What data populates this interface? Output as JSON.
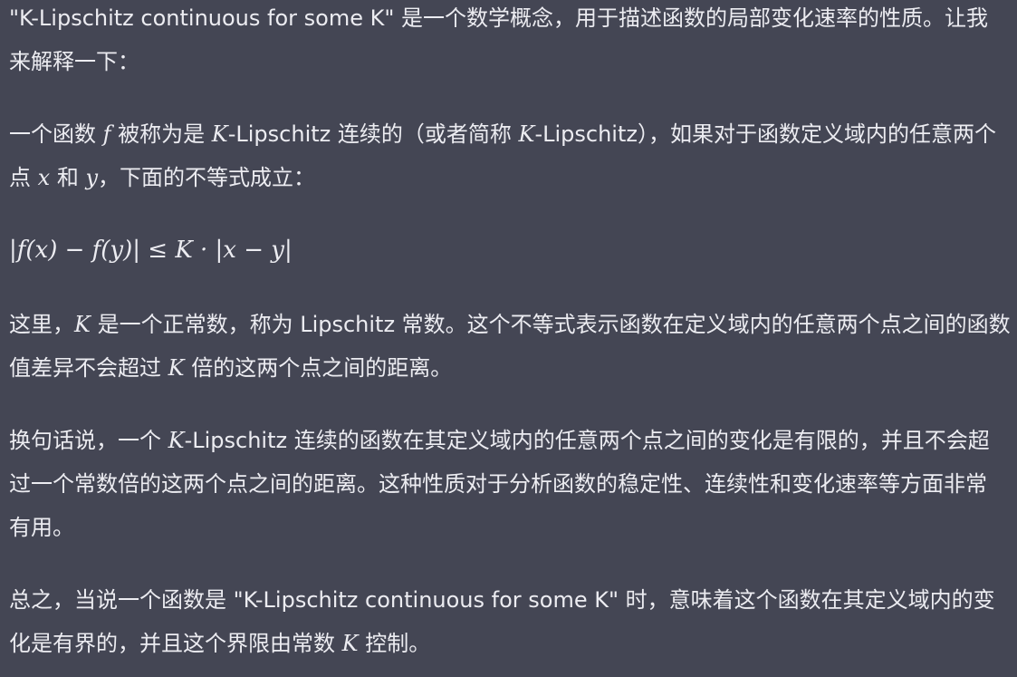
{
  "message": {
    "paragraph_1": "\"K-Lipschitz continuous for some K\" 是一个数学概念，用于描述函数的局部变化速率的性质。让我来解释一下：",
    "paragraph_2": {
      "part_1": "一个函数 ",
      "f": "f",
      "part_2": " 被称为是 ",
      "K1": "K",
      "part_3": "-Lipschitz 连续的（或者简称 ",
      "K2": "K",
      "part_4": "-Lipschitz），如果对于函数定义域内的任意两个点 ",
      "x": "x",
      "part_5": " 和 ",
      "y": "y",
      "part_6": "，下面的不等式成立："
    },
    "formula": "|f(x) − f(y)| ≤ K · |x − y|",
    "paragraph_3": {
      "part_1": "这里，",
      "K": "K",
      "part_2": " 是一个正常数，称为 Lipschitz 常数。这个不等式表示函数在定义域内的任意两个点之间的函数值差异不会超过 ",
      "K2": "K",
      "part_3": " 倍的这两个点之间的距离。"
    },
    "paragraph_4": {
      "part_1": "换句话说，一个 ",
      "K": "K",
      "part_2": "-Lipschitz 连续的函数在其定义域内的任意两个点之间的变化是有限的，并且不会超过一个常数倍的这两个点之间的距离。这种性质对于分析函数的稳定性、连续性和变化速率等方面非常有用。"
    },
    "paragraph_5": {
      "part_1": "总之，当说一个函数是 \"K-Lipschitz continuous for some K\" 时，意味着这个函数在其定义域内的变化是有界的，并且这个界限由常数 ",
      "K": "K",
      "part_2": " 控制。"
    }
  }
}
